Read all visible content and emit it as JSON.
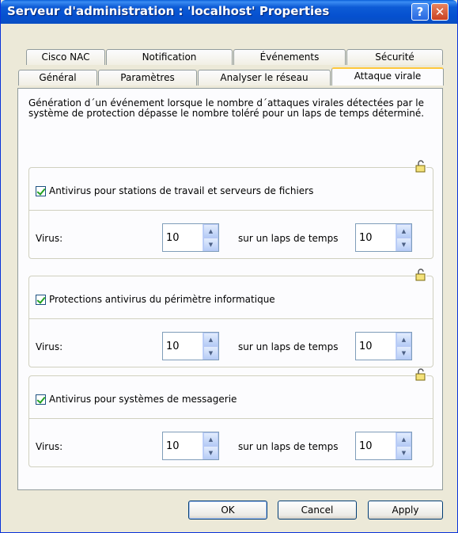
{
  "window": {
    "title": "Serveur d'administration : 'localhost' Properties",
    "help_label": "?",
    "close_label": "✕"
  },
  "tabs": {
    "row_top": [
      "Cisco NAC",
      "Notification",
      "Événements",
      "Sécurité"
    ],
    "row_bottom": [
      "Général",
      "Paramètres",
      "Analyser le réseau",
      "Attaque virale"
    ],
    "active": "Attaque virale"
  },
  "panel": {
    "description": "Génération d´un événement lorsque le nombre d´attaques virales détectées par le système de protection dépasse le nombre toléré pour un laps de temps déterminé.",
    "groups": [
      {
        "checkbox_label": "Antivirus pour stations de travail et serveurs de fichiers",
        "checked": true,
        "virus_label": "Virus:",
        "virus_value": "10",
        "lapse_label": "sur un laps de temps",
        "lapse_value": "10",
        "lock_icon": "lock-icon"
      },
      {
        "checkbox_label": "Protections antivirus du périmètre informatique",
        "checked": true,
        "virus_label": "Virus:",
        "virus_value": "10",
        "lapse_label": "sur un laps de temps",
        "lapse_value": "10",
        "lock_icon": "lock-icon"
      },
      {
        "checkbox_label": "Antivirus pour systèmes de messagerie",
        "checked": true,
        "virus_label": "Virus:",
        "virus_value": "10",
        "lapse_label": "sur un laps de temps",
        "lapse_value": "10",
        "lock_icon": "lock-icon"
      }
    ]
  },
  "buttons": {
    "ok": "OK",
    "cancel": "Cancel",
    "apply": "Apply"
  },
  "colors": {
    "titlebar": "#0550cf",
    "active_tab_accent": "#ffc83c",
    "close_button": "#c84121",
    "check_mark": "#21a121"
  }
}
